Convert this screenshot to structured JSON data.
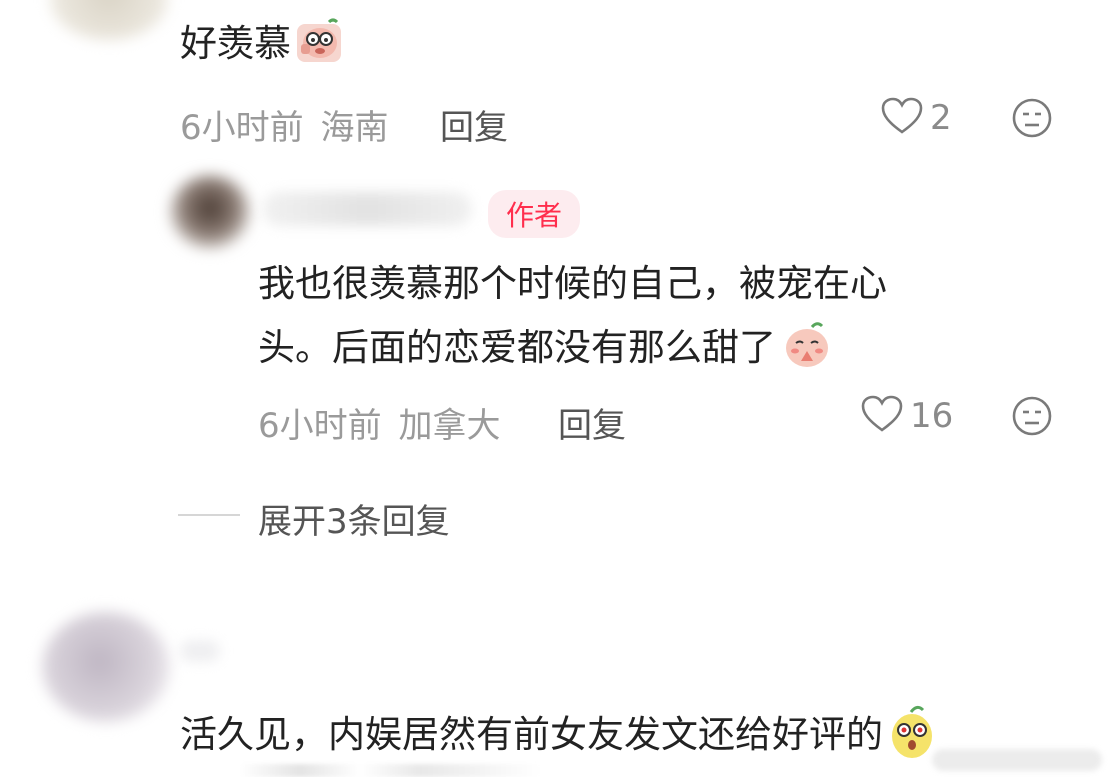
{
  "comment1": {
    "text": "好羡慕",
    "sticker_icon": "crying-pig-sticker",
    "time": "6小时前",
    "location": "海南",
    "reply_label": "回复",
    "likes": "2"
  },
  "author_reply": {
    "badge": "作者",
    "line1": "我也很羡慕那个时候的自己，被宠在心",
    "line2": "头。后面的恋爱都没有那么甜了",
    "sticker_icon": "praying-pig-sticker",
    "time": "6小时前",
    "location": "加拿大",
    "reply_label": "回复",
    "likes": "16"
  },
  "expand": {
    "label": "展开3条回复"
  },
  "comment2": {
    "text": "活久见，内娱居然有前女友发文还给好评的",
    "sticker_icon": "shocked-peach-sticker"
  },
  "colors": {
    "accent": "#ff2e4d",
    "meta_gray": "#9a9a9a",
    "badge_bg": "#fdecef"
  }
}
